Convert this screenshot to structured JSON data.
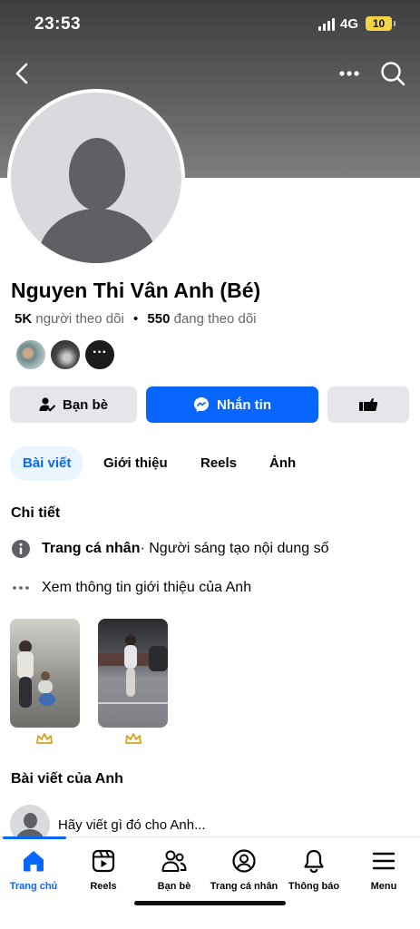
{
  "status_bar": {
    "time": "23:53",
    "network": "4G",
    "battery": "10"
  },
  "header": {
    "back_icon": "chevron-left-icon",
    "more_icon": "more-horizontal-icon",
    "search_icon": "search-icon"
  },
  "profile": {
    "name": "Nguyen Thi Vân Anh (Bé)",
    "followers_count": "5K",
    "followers_label": "người theo dõi",
    "separator": "•",
    "following_count": "550",
    "following_label": "đang theo dõi",
    "mutual_more_glyph": "···"
  },
  "actions": {
    "friends_label": "Bạn bè",
    "message_label": "Nhắn tin",
    "colors": {
      "primary": "#0866ff",
      "secondary": "#e4e6eb"
    }
  },
  "tabs": [
    {
      "label": "Bài viết",
      "active": true
    },
    {
      "label": "Giới thiệu",
      "active": false
    },
    {
      "label": "Reels",
      "active": false
    },
    {
      "label": "Ảnh",
      "active": false
    }
  ],
  "details": {
    "title": "Chi tiết",
    "page_type_bold": "Trang cá nhân",
    "page_type_rest": " · Người sáng tạo nội dung số",
    "see_intro": "Xem thông tin giới thiệu của Anh"
  },
  "posts": {
    "title": "Bài viết của Anh",
    "composer_placeholder": "Hãy viết gì đó cho Anh..."
  },
  "bottom_nav": [
    {
      "label": "Trang chủ",
      "icon": "home-icon",
      "active": true
    },
    {
      "label": "Reels",
      "icon": "reels-icon",
      "active": false
    },
    {
      "label": "Bạn bè",
      "icon": "friends-icon",
      "active": false
    },
    {
      "label": "Trang cá nhân",
      "icon": "profile-icon",
      "active": false
    },
    {
      "label": "Thông báo",
      "icon": "bell-icon",
      "active": false
    },
    {
      "label": "Menu",
      "icon": "menu-icon",
      "active": false
    }
  ]
}
